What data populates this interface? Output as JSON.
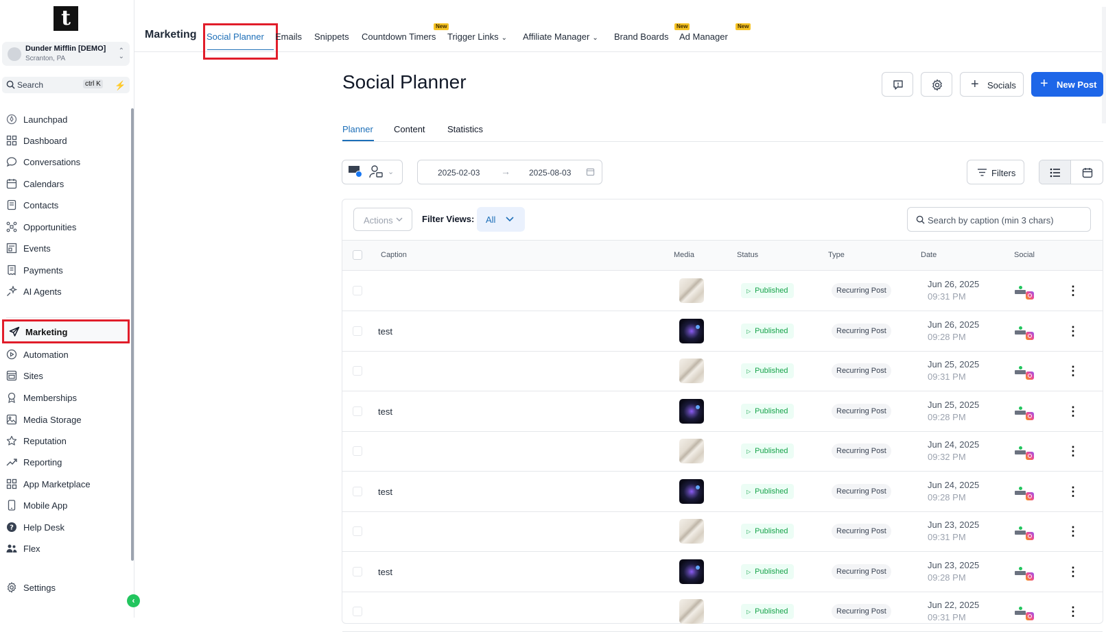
{
  "sidebar": {
    "logo": "t",
    "account": {
      "name": "Dunder Mifflin [DEMO]",
      "location": "Scranton, PA"
    },
    "search": {
      "label": "Search",
      "shortcut": "ctrl K"
    },
    "items": [
      {
        "label": "Launchpad",
        "icon": "rocket-icon"
      },
      {
        "label": "Dashboard",
        "icon": "grid-icon"
      },
      {
        "label": "Conversations",
        "icon": "chat-bubble-icon"
      },
      {
        "label": "Calendars",
        "icon": "calendar-icon"
      },
      {
        "label": "Contacts",
        "icon": "contacts-icon"
      },
      {
        "label": "Opportunities",
        "icon": "network-icon"
      },
      {
        "label": "Events",
        "icon": "events-icon"
      },
      {
        "label": "Payments",
        "icon": "receipt-icon"
      },
      {
        "label": "AI Agents",
        "icon": "sparkle-icon"
      },
      {
        "label": "Marketing",
        "icon": "send-icon"
      },
      {
        "label": "Automation",
        "icon": "play-circle-icon"
      },
      {
        "label": "Sites",
        "icon": "browser-icon"
      },
      {
        "label": "Memberships",
        "icon": "badge-icon"
      },
      {
        "label": "Media Storage",
        "icon": "image-icon"
      },
      {
        "label": "Reputation",
        "icon": "star-icon"
      },
      {
        "label": "Reporting",
        "icon": "trend-icon"
      },
      {
        "label": "App Marketplace",
        "icon": "apps-icon"
      },
      {
        "label": "Mobile App",
        "icon": "phone-icon"
      },
      {
        "label": "Help Desk",
        "icon": "help-icon"
      },
      {
        "label": "Flex",
        "icon": "users-icon"
      },
      {
        "label": "Settings",
        "icon": "gear-icon"
      }
    ]
  },
  "topnav": {
    "module": "Marketing",
    "tabs": [
      {
        "label": "Social Planner"
      },
      {
        "label": "Emails"
      },
      {
        "label": "Snippets"
      },
      {
        "label": "Countdown Timers",
        "badge": "New"
      },
      {
        "label": "Trigger Links"
      },
      {
        "label": "Affiliate Manager"
      },
      {
        "label": "Brand Boards",
        "badge": "New"
      },
      {
        "label": "Ad Manager",
        "badge": "New"
      }
    ]
  },
  "page": {
    "title": "Social Planner",
    "socials_label": "Socials",
    "new_post_label": "New Post",
    "subtabs": [
      "Planner",
      "Content",
      "Statistics"
    ],
    "date_from": "2025-02-03",
    "date_to": "2025-08-03",
    "filters_label": "Filters"
  },
  "table": {
    "actions_label": "Actions",
    "filter_views_label": "Filter Views:",
    "filter_views_value": "All",
    "search_placeholder": "Search by caption (min 3 chars)",
    "columns": [
      "Caption",
      "Media",
      "Status",
      "Type",
      "Date",
      "Social"
    ],
    "rows": [
      {
        "caption": "",
        "media": "paper",
        "status": "Published",
        "type": "Recurring Post",
        "date": "Jun 26, 2025",
        "time": "09:31 PM"
      },
      {
        "caption": "test",
        "media": "space",
        "status": "Published",
        "type": "Recurring Post",
        "date": "Jun 26, 2025",
        "time": "09:28 PM"
      },
      {
        "caption": "",
        "media": "paper",
        "status": "Published",
        "type": "Recurring Post",
        "date": "Jun 25, 2025",
        "time": "09:31 PM"
      },
      {
        "caption": "test",
        "media": "space",
        "status": "Published",
        "type": "Recurring Post",
        "date": "Jun 25, 2025",
        "time": "09:28 PM"
      },
      {
        "caption": "",
        "media": "paper",
        "status": "Published",
        "type": "Recurring Post",
        "date": "Jun 24, 2025",
        "time": "09:32 PM"
      },
      {
        "caption": "test",
        "media": "space",
        "status": "Published",
        "type": "Recurring Post",
        "date": "Jun 24, 2025",
        "time": "09:28 PM"
      },
      {
        "caption": "",
        "media": "paper",
        "status": "Published",
        "type": "Recurring Post",
        "date": "Jun 23, 2025",
        "time": "09:31 PM"
      },
      {
        "caption": "test",
        "media": "space",
        "status": "Published",
        "type": "Recurring Post",
        "date": "Jun 23, 2025",
        "time": "09:28 PM"
      },
      {
        "caption": "",
        "media": "paper",
        "status": "Published",
        "type": "Recurring Post",
        "date": "Jun 22, 2025",
        "time": "09:31 PM"
      }
    ]
  },
  "colors": {
    "accent": "#1d6fb8",
    "primary_button": "#1e66e8",
    "highlight": "#e11d2a",
    "success": "#16a34a",
    "badge": "#f6c324"
  }
}
